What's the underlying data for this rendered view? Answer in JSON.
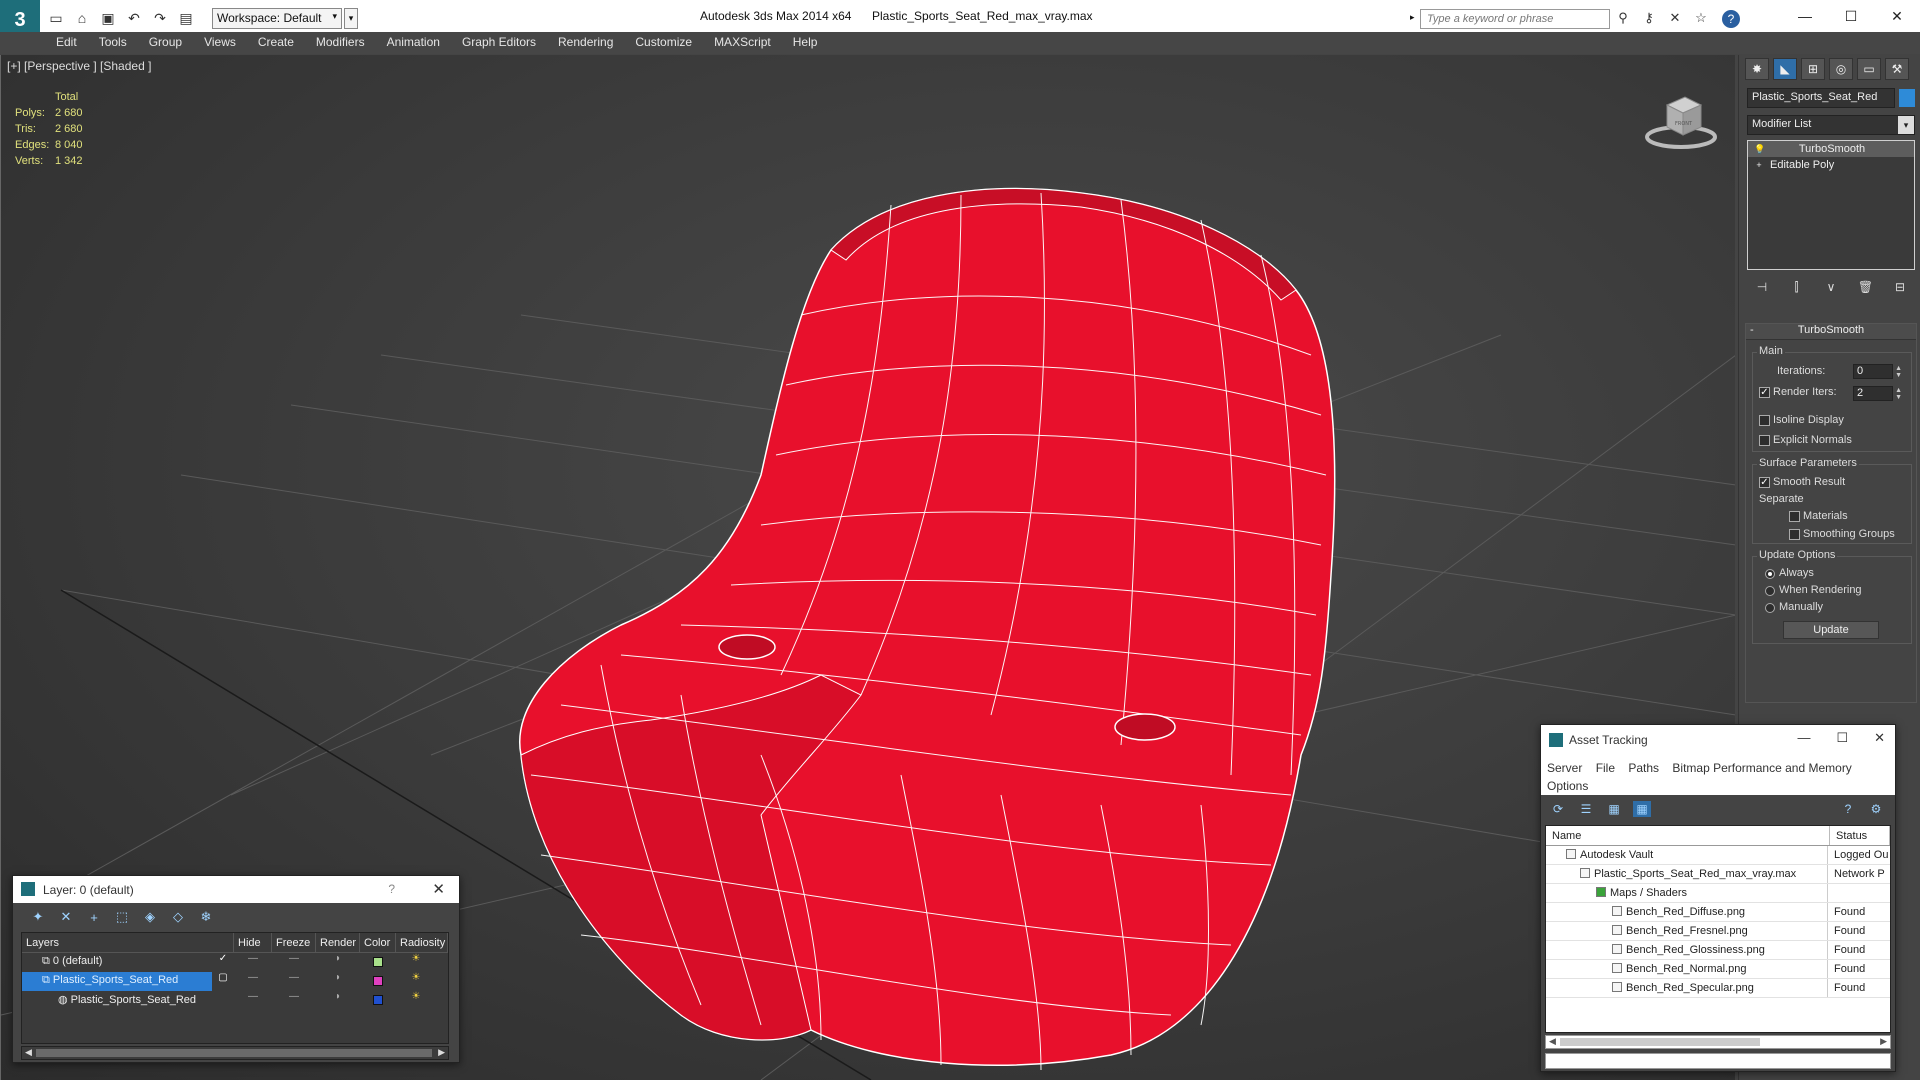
{
  "titlebar": {
    "workspace": "Workspace: Default",
    "app_title": "Autodesk 3ds Max  2014 x64",
    "file_title": "Plastic_Sports_Seat_Red_max_vray.max",
    "search_placeholder": "Type a keyword or phrase"
  },
  "menu": [
    "Edit",
    "Tools",
    "Group",
    "Views",
    "Create",
    "Modifiers",
    "Animation",
    "Graph Editors",
    "Rendering",
    "Customize",
    "MAXScript",
    "Help"
  ],
  "viewport": {
    "label": "[+] [Perspective ] [Shaded ]",
    "stats": {
      "header": "Total",
      "rows": [
        {
          "k": "Polys:",
          "v": "2 680"
        },
        {
          "k": "Tris:",
          "v": "2 680"
        },
        {
          "k": "Edges:",
          "v": "8 040"
        },
        {
          "k": "Verts:",
          "v": "1 342"
        }
      ]
    },
    "mesh_color": "#e8102c",
    "viewcube_label": "FRONT"
  },
  "command_panel": {
    "object_name": "Plastic_Sports_Seat_Red",
    "modifier_list": "Modifier List",
    "stack": [
      "TurboSmooth",
      "Editable Poly"
    ],
    "rollout_title": "TurboSmooth",
    "main_group": "Main",
    "iterations_label": "Iterations:",
    "iterations_value": "0",
    "render_iters_label": "Render Iters:",
    "render_iters_value": "2",
    "isoline_label": "Isoline Display",
    "explicit_normals_label": "Explicit Normals",
    "surface_group": "Surface Parameters",
    "smooth_result_label": "Smooth Result",
    "separate_label": "Separate",
    "materials_label": "Materials",
    "smoothing_groups_label": "Smoothing Groups",
    "update_group": "Update Options",
    "always_label": "Always",
    "when_rendering_label": "When Rendering",
    "manually_label": "Manually",
    "update_button": "Update"
  },
  "layer_window": {
    "title": "Layer: 0 (default)",
    "help": "?",
    "columns": [
      "Layers",
      "Hide",
      "Freeze",
      "Render",
      "Color",
      "Radiosity"
    ],
    "rows": [
      {
        "name": "0 (default)",
        "color": "#a8e08a"
      },
      {
        "name": "Plastic_Sports_Seat_Red",
        "color": "#e040c0"
      },
      {
        "name": "Plastic_Sports_Seat_Red",
        "color": "#2050d0"
      }
    ]
  },
  "asset_window": {
    "title": "Asset Tracking",
    "menu": [
      "Server",
      "File",
      "Paths",
      "Bitmap Performance and Memory",
      "Options"
    ],
    "columns": [
      "Name",
      "Status"
    ],
    "rows": [
      {
        "name": "Autodesk Vault",
        "status": "Logged Ou",
        "indent": 20
      },
      {
        "name": "Plastic_Sports_Seat_Red_max_vray.max",
        "status": "Network P",
        "indent": 34
      },
      {
        "name": "Maps / Shaders",
        "status": "",
        "indent": 50
      },
      {
        "name": "Bench_Red_Diffuse.png",
        "status": "Found",
        "indent": 66
      },
      {
        "name": "Bench_Red_Fresnel.png",
        "status": "Found",
        "indent": 66
      },
      {
        "name": "Bench_Red_Glossiness.png",
        "status": "Found",
        "indent": 66
      },
      {
        "name": "Bench_Red_Normal.png",
        "status": "Found",
        "indent": 66
      },
      {
        "name": "Bench_Red_Specular.png",
        "status": "Found",
        "indent": 66
      }
    ]
  }
}
